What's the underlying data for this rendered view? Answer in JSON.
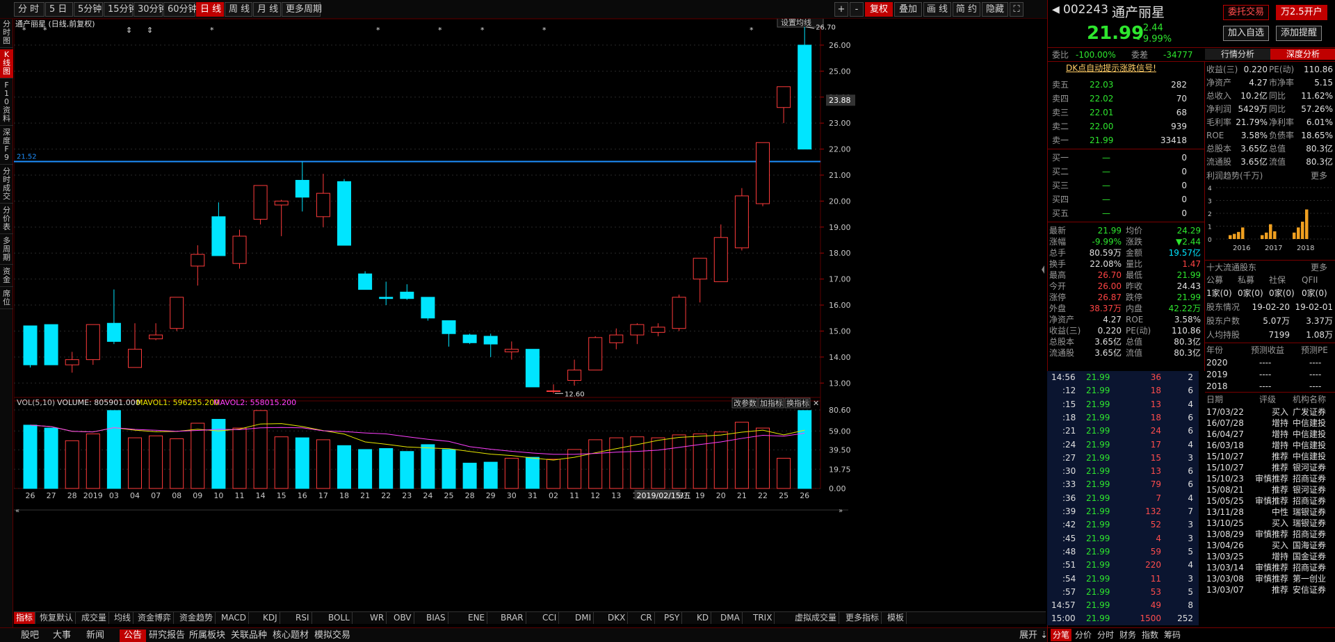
{
  "toolbar": {
    "left": [
      "分 时",
      "5 日",
      "5分钟",
      "15分钟",
      "30分钟",
      "60分钟",
      "日 线",
      "周 线",
      "月 线",
      "更多周期"
    ],
    "right": [
      "+",
      "-",
      "复权",
      "叠加",
      "画 线",
      "简 约",
      "隐藏"
    ]
  },
  "rail": [
    "分时图",
    "K线图",
    "F10资料",
    "深度F9",
    "分时成交",
    "分价表",
    "多周期",
    "资金",
    "席位"
  ],
  "chart": {
    "title": "通产丽星 (日线,前复权)",
    "settings": "设置均线",
    "price_line_label": "21.52",
    "current_price_tag": "23.88",
    "high_label": "26.70",
    "low_label": "12.60",
    "price_ticks": [
      "26.00",
      "25.00",
      "24.00",
      "23.00",
      "22.00",
      "21.00",
      "20.00",
      "19.00",
      "18.00",
      "17.00",
      "16.00",
      "15.00",
      "14.00",
      "13.00"
    ],
    "vol_header": {
      "name": "VOL(5,10)",
      "volume": "VOLUME: 805901.000",
      "mavol1": "MAVOL1: 596255.200",
      "mavol2": "MAVOL2: 558015.200"
    },
    "vol_buttons": [
      "改参数",
      "加指标",
      "换指标"
    ],
    "vol_ticks": [
      "80.60",
      "59.00",
      "39.50",
      "19.75",
      "0.00"
    ],
    "date_labels": [
      "26",
      "27",
      "28",
      "2019",
      "03",
      "04",
      "07",
      "08",
      "09",
      "10",
      "11",
      "14",
      "15",
      "16",
      "17",
      "18",
      "21",
      "22",
      "23",
      "24",
      "25",
      "28",
      "29",
      "30",
      "31",
      "02",
      "11",
      "12",
      "13",
      "14",
      "15",
      "18",
      "19",
      "20",
      "21",
      "22",
      "25",
      "26"
    ],
    "cursor_date": "2019/02/15/五"
  },
  "chart_data": {
    "type": "candlestick",
    "candles": [
      {
        "o": 15.2,
        "h": 15.2,
        "l": 13.6,
        "c": 13.7
      },
      {
        "o": 15.25,
        "h": 15.25,
        "l": 13.7,
        "c": 13.7
      },
      {
        "o": 13.7,
        "h": 14.2,
        "l": 13.4,
        "c": 13.9
      },
      {
        "o": 13.9,
        "h": 15.25,
        "l": 13.7,
        "c": 15.25
      },
      {
        "o": 15.3,
        "h": 16.6,
        "l": 14.5,
        "c": 14.6
      },
      {
        "o": 13.6,
        "h": 15.3,
        "l": 13.6,
        "c": 14.3
      },
      {
        "o": 14.7,
        "h": 15.3,
        "l": 14.65,
        "c": 14.85
      },
      {
        "o": 15.1,
        "h": 16.3,
        "l": 15.0,
        "c": 16.3
      },
      {
        "o": 17.5,
        "h": 18.3,
        "l": 16.75,
        "c": 17.95
      },
      {
        "o": 19.4,
        "h": 19.95,
        "l": 17.9,
        "c": 17.9
      },
      {
        "o": 17.6,
        "h": 18.9,
        "l": 17.4,
        "c": 18.65
      },
      {
        "o": 19.3,
        "h": 20.6,
        "l": 19.1,
        "c": 20.6
      },
      {
        "o": 19.85,
        "h": 20.05,
        "l": 18.65,
        "c": 20.0
      },
      {
        "o": 20.8,
        "h": 21.52,
        "l": 19.6,
        "c": 20.15
      },
      {
        "o": 19.4,
        "h": 21.05,
        "l": 19.0,
        "c": 20.3
      },
      {
        "o": 20.75,
        "h": 20.85,
        "l": 18.3,
        "c": 18.3
      },
      {
        "o": 17.2,
        "h": 17.3,
        "l": 16.6,
        "c": 16.6
      },
      {
        "o": 16.3,
        "h": 16.9,
        "l": 16.0,
        "c": 16.25
      },
      {
        "o": 16.5,
        "h": 16.8,
        "l": 16.2,
        "c": 16.25
      },
      {
        "o": 16.3,
        "h": 16.3,
        "l": 15.4,
        "c": 15.5
      },
      {
        "o": 15.4,
        "h": 15.4,
        "l": 14.4,
        "c": 14.9
      },
      {
        "o": 14.85,
        "h": 14.9,
        "l": 14.5,
        "c": 14.55
      },
      {
        "o": 14.8,
        "h": 14.9,
        "l": 14.0,
        "c": 14.5
      },
      {
        "o": 14.2,
        "h": 14.6,
        "l": 13.9,
        "c": 14.3
      },
      {
        "o": 14.3,
        "h": 14.3,
        "l": 12.85,
        "c": 12.85
      },
      {
        "o": 12.7,
        "h": 12.95,
        "l": 12.6,
        "c": 12.7
      },
      {
        "o": 13.1,
        "h": 13.9,
        "l": 12.9,
        "c": 13.5
      },
      {
        "o": 13.5,
        "h": 14.8,
        "l": 13.5,
        "c": 14.75
      },
      {
        "o": 14.55,
        "h": 15.1,
        "l": 14.3,
        "c": 14.85
      },
      {
        "o": 14.85,
        "h": 15.3,
        "l": 14.5,
        "c": 15.25
      },
      {
        "o": 14.95,
        "h": 15.3,
        "l": 14.8,
        "c": 15.15
      },
      {
        "o": 15.1,
        "h": 16.4,
        "l": 15.0,
        "c": 16.3
      },
      {
        "o": 17.0,
        "h": 17.3,
        "l": 16.1,
        "c": 17.8
      },
      {
        "o": 16.9,
        "h": 19.1,
        "l": 16.9,
        "c": 18.6
      },
      {
        "o": 18.2,
        "h": 20.5,
        "l": 18.1,
        "c": 20.2
      },
      {
        "o": 19.9,
        "h": 22.25,
        "l": 19.8,
        "c": 22.25
      },
      {
        "o": 23.6,
        "h": 24.4,
        "l": 23.0,
        "c": 24.4
      },
      {
        "o": 26.0,
        "h": 26.7,
        "l": 22.0,
        "c": 22.0
      }
    ],
    "volume_rel": [
      65,
      62,
      49,
      56,
      80,
      52,
      54,
      51,
      67,
      71,
      62,
      80,
      53,
      52,
      50,
      44,
      40,
      41,
      38,
      45,
      40,
      26,
      27,
      31,
      32,
      30,
      40,
      50,
      52,
      53,
      52,
      55,
      56,
      58,
      68,
      62,
      31,
      80
    ],
    "ylim": [
      12.5,
      26.8
    ],
    "vol_ylim": [
      0,
      80.6
    ]
  },
  "stock": {
    "code": "002243",
    "name": "通产丽星",
    "price": "21.99",
    "change": "- 2.44",
    "pct": "- 9.99%"
  },
  "buttons": {
    "delegate": "委托交易",
    "open": "万2.5开户",
    "add_watch": "加入自选",
    "add_alert": "添加提醒"
  },
  "order_ratio": {
    "label1": "委比",
    "val1": "-100.00%",
    "label2": "委差",
    "val2": "-34777"
  },
  "tabs2": [
    "行情分析",
    "深度分析"
  ],
  "signal": "DK点自动提示涨跌信号!",
  "asks": [
    {
      "label": "卖五",
      "price": "22.03",
      "vol": "282"
    },
    {
      "label": "卖四",
      "price": "22.02",
      "vol": "70"
    },
    {
      "label": "卖三",
      "price": "22.01",
      "vol": "68"
    },
    {
      "label": "卖二",
      "price": "22.00",
      "vol": "939"
    },
    {
      "label": "卖一",
      "price": "21.99",
      "vol": "33418"
    }
  ],
  "bids": [
    {
      "label": "买一",
      "price": "—",
      "vol": "0"
    },
    {
      "label": "买二",
      "price": "—",
      "vol": "0"
    },
    {
      "label": "买三",
      "price": "—",
      "vol": "0"
    },
    {
      "label": "买四",
      "price": "—",
      "vol": "0"
    },
    {
      "label": "买五",
      "price": "—",
      "vol": "0"
    }
  ],
  "quote": [
    [
      "最新",
      "21.99",
      "均价",
      "24.29"
    ],
    [
      "涨幅",
      "-9.99%",
      "涨跌",
      "▼2.44"
    ],
    [
      "总手",
      "80.59万",
      "金额",
      "19.57亿"
    ],
    [
      "换手",
      "22.08%",
      "量比",
      "1.47"
    ],
    [
      "最高",
      "26.70",
      "最低",
      "21.99"
    ],
    [
      "今开",
      "26.00",
      "昨收",
      "24.43"
    ],
    [
      "涨停",
      "26.87",
      "跌停",
      "21.99"
    ],
    [
      "外盘",
      "38.37万",
      "内盘",
      "42.22万"
    ],
    [
      "净资产",
      "4.27",
      "ROE",
      "3.58%"
    ],
    [
      "收益(三)",
      "0.220",
      "PE(动)",
      "110.86"
    ],
    [
      "总股本",
      "3.65亿",
      "总值",
      "80.3亿"
    ],
    [
      "流通股",
      "3.65亿",
      "流值",
      "80.3亿"
    ]
  ],
  "ticks": [
    [
      "14:56",
      "21.99",
      "36",
      "2"
    ],
    [
      ":12",
      "21.99",
      "18",
      "6"
    ],
    [
      ":15",
      "21.99",
      "13",
      "4"
    ],
    [
      ":18",
      "21.99",
      "18",
      "6"
    ],
    [
      ":21",
      "21.99",
      "24",
      "6"
    ],
    [
      ":24",
      "21.99",
      "17",
      "4"
    ],
    [
      ":27",
      "21.99",
      "15",
      "3"
    ],
    [
      ":30",
      "21.99",
      "13",
      "6"
    ],
    [
      ":33",
      "21.99",
      "79",
      "6"
    ],
    [
      ":36",
      "21.99",
      "7",
      "4"
    ],
    [
      ":39",
      "21.99",
      "132",
      "7"
    ],
    [
      ":42",
      "21.99",
      "52",
      "3"
    ],
    [
      ":45",
      "21.99",
      "4",
      "3"
    ],
    [
      ":48",
      "21.99",
      "59",
      "5"
    ],
    [
      ":51",
      "21.99",
      "220",
      "4"
    ],
    [
      ":54",
      "21.99",
      "11",
      "3"
    ],
    [
      ":57",
      "21.99",
      "53",
      "5"
    ],
    [
      "14:57",
      "21.99",
      "49",
      "8"
    ],
    [
      "15:00",
      "21.99",
      "1500",
      "252"
    ]
  ],
  "fund": [
    [
      "收益(三)",
      "0.220",
      "PE(动)",
      "110.86"
    ],
    [
      "净资产",
      "4.27",
      "市净率",
      "5.15"
    ],
    [
      "总收入",
      "10.2亿",
      "同比",
      "11.62%"
    ],
    [
      "净利润",
      "5429万",
      "同比",
      "57.26%"
    ],
    [
      "毛利率",
      "21.79%",
      "净利率",
      "6.01%"
    ],
    [
      "ROE",
      "3.58%",
      "负债率",
      "18.65%"
    ],
    [
      "总股本",
      "3.65亿",
      "总值",
      "80.3亿"
    ],
    [
      "流通股",
      "3.65亿",
      "流值",
      "80.3亿"
    ]
  ],
  "profit_trend": {
    "title": "利润趋势(千万)",
    "more": "更多",
    "years": [
      "2016",
      "2017",
      "2018"
    ],
    "ticks": [
      "4",
      "3",
      "2",
      "1",
      "0"
    ],
    "bars": [
      0.3,
      0.4,
      0.55,
      0.9,
      0.3,
      0.5,
      1.15,
      0.6,
      0.5,
      0.9,
      1.35,
      2.3
    ]
  },
  "holders": {
    "title": "十大流通股东",
    "more": "更多",
    "cols": [
      "公募",
      "私募",
      "社保",
      "QFII"
    ],
    "vals": [
      "1家(0)",
      "0家(0)",
      "0家(0)",
      "0家(0)"
    ],
    "rows": [
      [
        "股东情况",
        "19-02-20",
        "19-02-01"
      ],
      [
        "股东户数",
        "5.07万",
        "3.37万"
      ],
      [
        "人均持股",
        "7199",
        "1.08万"
      ]
    ]
  },
  "forecast": {
    "cols": [
      "年份",
      "预测收益",
      "预测PE"
    ],
    "rows": [
      [
        "2020",
        "----",
        "----"
      ],
      [
        "2019",
        "----",
        "----"
      ],
      [
        "2018",
        "----",
        "----"
      ]
    ]
  },
  "ratings": {
    "cols": [
      "日期",
      "评级",
      "机构名称"
    ],
    "rows": [
      [
        "17/03/22",
        "买入",
        "广发证券"
      ],
      [
        "16/07/28",
        "增持",
        "中信建投"
      ],
      [
        "16/04/27",
        "增持",
        "中信建投"
      ],
      [
        "16/03/18",
        "增持",
        "中信建投"
      ],
      [
        "15/10/27",
        "推荐",
        "中信建投"
      ],
      [
        "15/10/27",
        "推荐",
        "银河证券"
      ],
      [
        "15/10/23",
        "审慎推荐",
        "招商证券"
      ],
      [
        "15/08/21",
        "推荐",
        "银河证券"
      ],
      [
        "15/05/25",
        "审慎推荐",
        "招商证券"
      ],
      [
        "13/11/28",
        "中性",
        "瑞银证券"
      ],
      [
        "13/10/25",
        "买入",
        "瑞银证券"
      ],
      [
        "13/08/29",
        "审慎推荐",
        "招商证券"
      ],
      [
        "13/04/26",
        "买入",
        "国海证券"
      ],
      [
        "13/03/25",
        "增持",
        "国金证券"
      ],
      [
        "13/03/14",
        "审慎推荐",
        "招商证券"
      ],
      [
        "13/03/08",
        "审慎推荐",
        "第一创业"
      ],
      [
        "13/03/07",
        "推荐",
        "安信证券"
      ]
    ]
  },
  "bottom_tabs_right": [
    "分笔",
    "分价",
    "分时",
    "财务",
    "指数",
    "筹码"
  ],
  "indicator_tabs": [
    "指标",
    "恢复默认",
    "成交量",
    "均线",
    "资金博弈",
    "资金趋势",
    "MACD",
    "KDJ",
    "RSI",
    "BOLL",
    "WR",
    "OBV",
    "BIAS",
    "ENE",
    "BRAR",
    "CCI",
    "DMI",
    "DKX",
    "CR",
    "PSY",
    "KD",
    "DMA",
    "TRIX",
    "虚拟成交量",
    "更多指标",
    "模板"
  ],
  "nav_tabs": [
    "股吧",
    "大事",
    "新闻",
    "公告",
    "研究报告",
    "所属板块",
    "关联品种",
    "核心题材",
    "模拟交易"
  ],
  "expand": "展开 ⇣",
  "colors": {
    "up": "#ff3b3b",
    "down": "#00e5ff",
    "bg": "#000000",
    "accent": "#c00000",
    "hline": "#1e90ff",
    "ma1": "#e8e800",
    "ma2": "#ff40ff"
  }
}
